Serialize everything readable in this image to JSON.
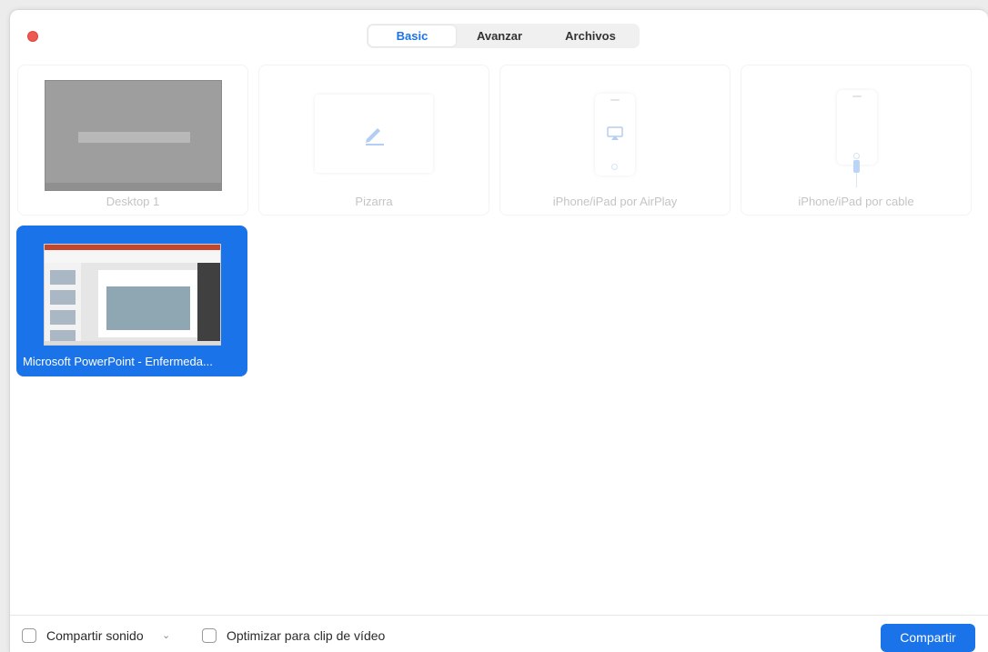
{
  "tabs": [
    {
      "label": "Basic",
      "active": true
    },
    {
      "label": "Avanzar",
      "active": false
    },
    {
      "label": "Archivos",
      "active": false
    }
  ],
  "sources": [
    {
      "label": "Desktop 1",
      "icon": "desktop-thumbnail"
    },
    {
      "label": "Pizarra",
      "icon": "pencil-icon"
    },
    {
      "label": "iPhone/iPad por AirPlay",
      "icon": "airplay-icon"
    },
    {
      "label": "iPhone/iPad por cable",
      "icon": "cable-icon"
    },
    {
      "label": "Microsoft PowerPoint - Enfermeda...",
      "icon": "powerpoint-thumbnail",
      "selected": true
    }
  ],
  "footer": {
    "share_sound_label": "Compartir sonido",
    "share_sound_caret": "⌄",
    "optimize_video_label": "Optimizar para clip de vídeo",
    "share_button": "Compartir"
  },
  "colors": {
    "accent": "#1a73e8",
    "close": "#ee5a52"
  }
}
